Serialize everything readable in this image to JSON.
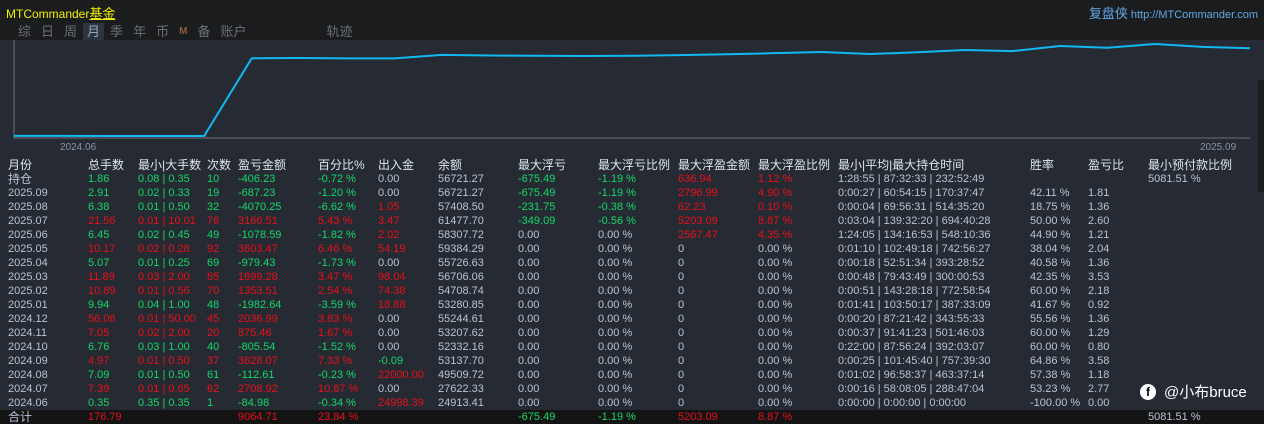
{
  "header": {
    "brand": "MTCommander",
    "brand_suffix": "基金",
    "site_cn": "复盘侠",
    "site_url": "http://MTCommander.com"
  },
  "tabs": [
    {
      "label": "综"
    },
    {
      "label": "日"
    },
    {
      "label": "周"
    },
    {
      "label": "月",
      "selected": true
    },
    {
      "label": "季"
    },
    {
      "label": "年"
    },
    {
      "label": "币"
    },
    {
      "label": "M"
    },
    {
      "label": "备"
    },
    {
      "label": "账户"
    },
    {
      "label": "轨迹"
    }
  ],
  "chart": {
    "x_labels": [
      "2024.06",
      "2025.09"
    ],
    "line_color": "#12b8f0",
    "equity": [
      24913.41,
      24913.41,
      24900,
      24880,
      24880,
      52000,
      52100,
      52000,
      52000,
      53200,
      53000,
      52900,
      52800,
      52900,
      53100,
      53400,
      53800,
      54200,
      53500,
      54100,
      54900,
      54500,
      56300,
      55700,
      57000,
      56000,
      55500
    ]
  },
  "columns": [
    "月份",
    "总手数",
    "最小|大手数",
    "次数",
    "盈亏金额",
    "百分比%",
    "出入金",
    "余额",
    "最大浮亏",
    "最大浮亏比例",
    "最大浮盈金额",
    "最大浮盈比例",
    "最小|平均|最大持仓时间",
    "胜率",
    "盈亏比",
    "最小预付款比例"
  ],
  "rows": [
    [
      "持仓",
      "1.86",
      "0.08 | 0.35",
      "10",
      "-406.23",
      "-0.72 %",
      "0.00",
      "56721.27",
      "-675.49",
      "-1.19 %",
      "636.94",
      "1.12 %",
      "1:28:55 | 87:32:33 | 232:52:49",
      "",
      "",
      "5081.51 %"
    ],
    [
      "2025.09",
      "2.91",
      "0.02 | 0.33",
      "19",
      "-687.23",
      "-1.20 %",
      "0.00",
      "56721.27",
      "-675.49",
      "-1.19 %",
      "2796.99",
      "4.90 %",
      "0:00:27 | 60:54:15 | 170:37:47",
      "42.11 %",
      "1.81",
      ""
    ],
    [
      "2025.08",
      "6.38",
      "0.01 | 0.50",
      "32",
      "-4070.25",
      "-6.62 %",
      "1.05",
      "57408.50",
      "-231.75",
      "-0.38 %",
      "62.23",
      "0.10 %",
      "0:00:04 | 69:56:31 | 514:35:20",
      "18.75 %",
      "1.36",
      ""
    ],
    [
      "2025.07",
      "21.56",
      "0.01 | 10.01",
      "76",
      "3166.51",
      "5.43 %",
      "3.47",
      "61477.70",
      "-349.09",
      "-0.56 %",
      "5203.09",
      "8.87 %",
      "0:03:04 | 139:32:20 | 694:40:28",
      "50.00 %",
      "2.60",
      ""
    ],
    [
      "2025.06",
      "6.45",
      "0.02 | 0.45",
      "49",
      "-1078.59",
      "-1.82 %",
      "2.02",
      "58307.72",
      "0.00",
      "0.00 %",
      "2567.47",
      "4.35 %",
      "1:24:05 | 134:16:53 | 548:10:36",
      "44.90 %",
      "1.21",
      ""
    ],
    [
      "2025.05",
      "10.17",
      "0.02 | 0.28",
      "92",
      "3603.47",
      "6.46 %",
      "54.19",
      "59384.29",
      "0.00",
      "0.00 %",
      "0",
      "0.00 %",
      "0:01:10 | 102:49:18 | 742:56:27",
      "38.04 %",
      "2.04",
      ""
    ],
    [
      "2025.04",
      "5.07",
      "0.01 | 0.25",
      "69",
      "-979.43",
      "-1.73 %",
      "0.00",
      "55726.63",
      "0.00",
      "0.00 %",
      "0",
      "0.00 %",
      "0:00:18 | 52:51:34 | 393:28:52",
      "40.58 %",
      "1.36",
      ""
    ],
    [
      "2025.03",
      "11.89",
      "0.03 | 2.00",
      "85",
      "1899.28",
      "3.47 %",
      "98.04",
      "56706.06",
      "0.00",
      "0.00 %",
      "0",
      "0.00 %",
      "0:00:48 | 79:43:49 | 300:00:53",
      "42.35 %",
      "3.53",
      ""
    ],
    [
      "2025.02",
      "10.89",
      "0.01 | 0.56",
      "70",
      "1353.51",
      "2.54 %",
      "74.38",
      "54708.74",
      "0.00",
      "0.00 %",
      "0",
      "0.00 %",
      "0:00:51 | 143:28:18 | 772:58:54",
      "60.00 %",
      "2.18",
      ""
    ],
    [
      "2025.01",
      "9.94",
      "0.04 | 1.00",
      "48",
      "-1982.64",
      "-3.59 %",
      "18.88",
      "53280.85",
      "0.00",
      "0.00 %",
      "0",
      "0.00 %",
      "0:01:41 | 103:50:17 | 387:33:09",
      "41.67 %",
      "0.92",
      ""
    ],
    [
      "2024.12",
      "56.06",
      "0.01 | 50.00",
      "45",
      "2036.99",
      "3.83 %",
      "0.00",
      "55244.61",
      "0.00",
      "0.00 %",
      "0",
      "0.00 %",
      "0:00:20 | 87:21:42 | 343:55:33",
      "55.56 %",
      "1.36",
      ""
    ],
    [
      "2024.11",
      "7.05",
      "0.02 | 2.00",
      "20",
      "875.46",
      "1.67 %",
      "0.00",
      "53207.62",
      "0.00",
      "0.00 %",
      "0",
      "0.00 %",
      "0:00:37 | 91:41:23 | 501:46:03",
      "60.00 %",
      "1.29",
      ""
    ],
    [
      "2024.10",
      "6.76",
      "0.03 | 1.00",
      "40",
      "-805.54",
      "-1.52 %",
      "0.00",
      "52332.16",
      "0.00",
      "0.00 %",
      "0",
      "0.00 %",
      "0:22:00 | 87:56:24 | 392:03:07",
      "60.00 %",
      "0.80",
      ""
    ],
    [
      "2024.09",
      "4.97",
      "0.01 | 0.50",
      "37",
      "3628.07",
      "7.33 %",
      "-0.09",
      "53137.70",
      "0.00",
      "0.00 %",
      "0",
      "0.00 %",
      "0:00:25 | 101:45:40 | 757:39:30",
      "64.86 %",
      "3.58",
      ""
    ],
    [
      "2024.08",
      "7.09",
      "0.01 | 0.50",
      "61",
      "-112.61",
      "-0.23 %",
      "22000.00",
      "49509.72",
      "0.00",
      "0.00 %",
      "0",
      "0.00 %",
      "0:01:02 | 96:58:37 | 463:37:14",
      "57.38 %",
      "1.18",
      ""
    ],
    [
      "2024.07",
      "7.39",
      "0.01 | 0.65",
      "62",
      "2708.92",
      "10.87 %",
      "0.00",
      "27622.33",
      "0.00",
      "0.00 %",
      "0",
      "0.00 %",
      "0:00:16 | 58:08:05 | 288:47:04",
      "53.23 %",
      "2.77",
      ""
    ],
    [
      "2024.06",
      "0.35",
      "0.35 | 0.35",
      "1",
      "-84.98",
      "-0.34 %",
      "24998.39",
      "24913.41",
      "0.00",
      "0.00 %",
      "0",
      "0.00 %",
      "0:00:00 | 0:00:00 | 0:00:00",
      "-100.00 %",
      "0.00",
      ""
    ]
  ],
  "total": [
    "合计",
    "176.79",
    "",
    "",
    "9064.71",
    "23.84 %",
    "",
    "",
    "-675.49",
    "-1.19 %",
    "5203.09",
    "8.87 %",
    "",
    "",
    "",
    "5081.51 %"
  ],
  "watermark": "@小布bruce",
  "colors": {
    "profit": "#e8101a",
    "loss": "#12d868",
    "neutral": "#b8c4d6"
  }
}
